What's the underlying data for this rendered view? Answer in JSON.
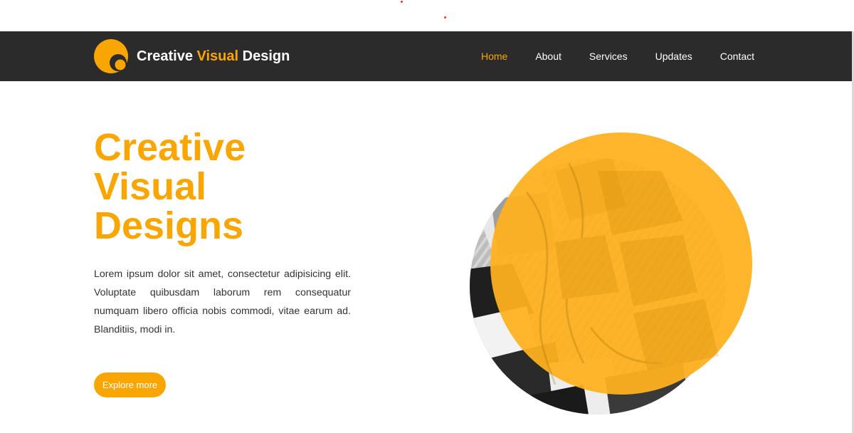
{
  "brand": {
    "name_part1": "Creative",
    "name_accent": "Visual",
    "name_part2": "Design",
    "logo_icon": "crescent-logo-icon",
    "accent_color": "#f9a602"
  },
  "nav": {
    "items": [
      {
        "label": "Home",
        "active": true
      },
      {
        "label": "About",
        "active": false
      },
      {
        "label": "Services",
        "active": false
      },
      {
        "label": "Updates",
        "active": false
      },
      {
        "label": "Contact",
        "active": false
      }
    ]
  },
  "hero": {
    "title_lines": [
      "Creative",
      "Visual",
      "Designs"
    ],
    "description": "Lorem ipsum dolor sit amet, consectetur adipisicing elit. Voluptate quibusdam laborum rem consequatur numquam libero officia nobis commodi, vitae earum ad. Blanditiis, modi in.",
    "cta_label": "Explore more"
  },
  "colors": {
    "navbar_bg": "#2b2b2b",
    "accent": "#f9a602",
    "circle_overlay": "#ffb11f",
    "text": "#333333"
  }
}
